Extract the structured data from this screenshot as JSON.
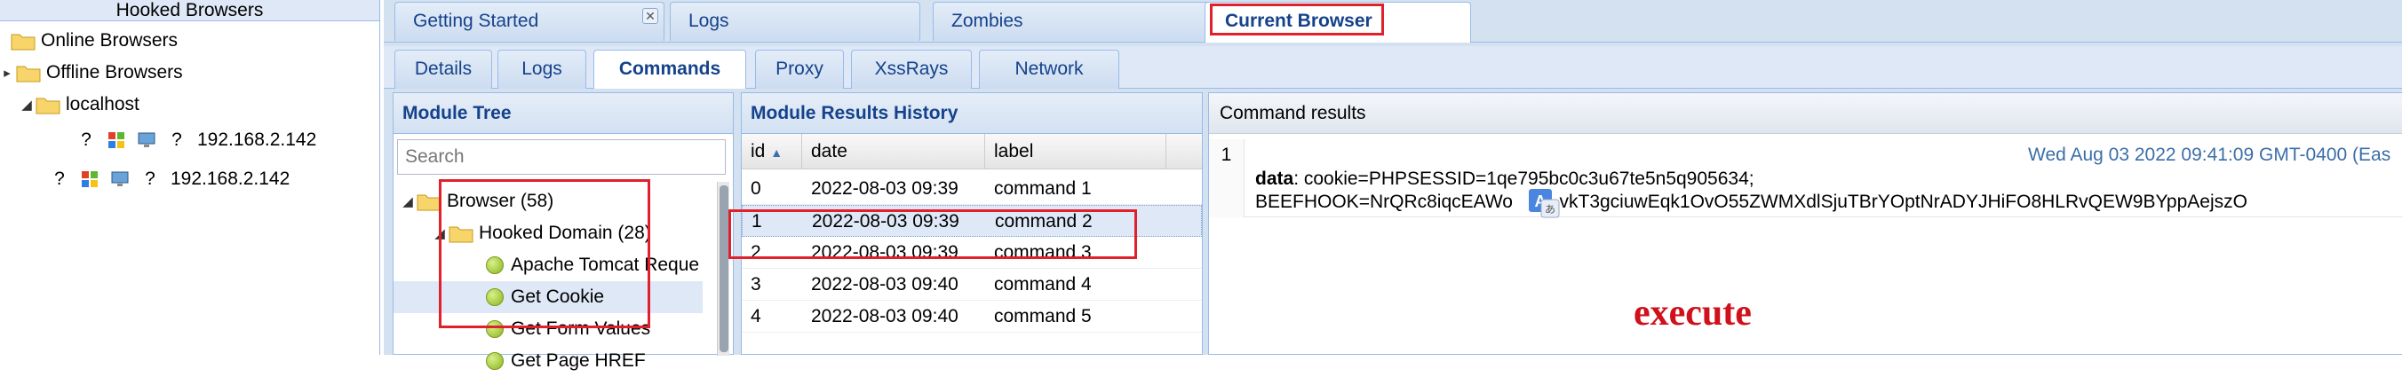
{
  "left_panel": {
    "header": "Hooked Browsers",
    "online": "Online Browsers",
    "offline": "Offline Browsers",
    "host": "localhost",
    "browsers": [
      {
        "ip": "192.168.2.142"
      },
      {
        "ip": "192.168.2.142"
      }
    ]
  },
  "tabs": {
    "getting_started": "Getting Started",
    "close": "✕",
    "logs": "Logs",
    "zombies": "Zombies",
    "current_browser": "Current Browser"
  },
  "subtabs": [
    "Details",
    "Logs",
    "Commands",
    "Proxy",
    "XssRays",
    "Network"
  ],
  "module_tree": {
    "title": "Module Tree",
    "search_placeholder": "Search",
    "browser": "Browser (58)",
    "hooked_domain": "Hooked Domain (28)",
    "items": [
      "Apache Tomcat Reque",
      "Get Cookie",
      "Get Form Values",
      "Get Page HREF"
    ]
  },
  "history": {
    "title": "Module Results History",
    "columns": [
      "id",
      "date",
      "label"
    ],
    "rows": [
      {
        "id": "0",
        "date": "2022-08-03 09:39",
        "label": "command 1"
      },
      {
        "id": "1",
        "date": "2022-08-03 09:39",
        "label": "command 2"
      },
      {
        "id": "2",
        "date": "2022-08-03 09:39",
        "label": "command 3"
      },
      {
        "id": "3",
        "date": "2022-08-03 09:40",
        "label": "command 4"
      },
      {
        "id": "4",
        "date": "2022-08-03 09:40",
        "label": "command 5"
      }
    ]
  },
  "results": {
    "title": "Command results",
    "row_num": "1",
    "timestamp": "Wed Aug 03 2022 09:41:09 GMT-0400 (Eas",
    "data_key": "data",
    "data_line1": ": cookie=PHPSESSID=1qe795bc0c3u67te5n5q905634;",
    "data_line2": "BEEFHOOK=NrQRc8iqcEAWo         vkT3gciuwEqk1OvO55ZWMXdlSjuTBrYOptNrADYJHiFO8HLRvQEW9BYppAejszO"
  },
  "annotation": "execute",
  "colors": {
    "accent": "#15428b",
    "highlight": "#e0202a",
    "annotation": "#d0101a"
  }
}
